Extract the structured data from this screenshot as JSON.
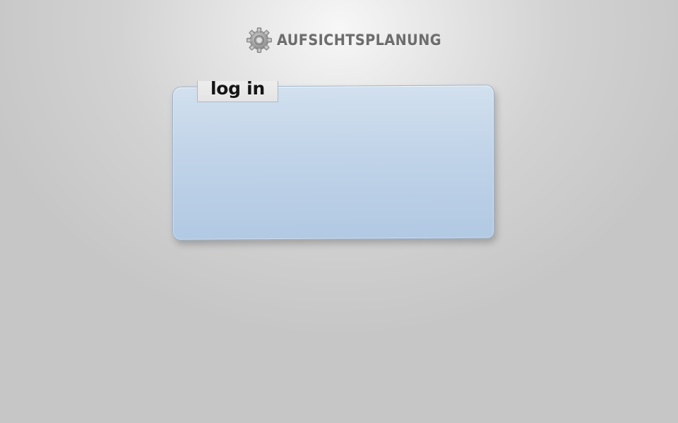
{
  "header": {
    "logo_icon": "gear-icon",
    "title": "AUFSICHTSPLANUNG"
  },
  "login": {
    "tab_label": "log in"
  },
  "colors": {
    "panel": "#c0d3e8",
    "panel_border": "#9cb3cc",
    "tab": "#e8e8e8",
    "title_text": "#6d6d6d",
    "tab_text": "#151515"
  }
}
